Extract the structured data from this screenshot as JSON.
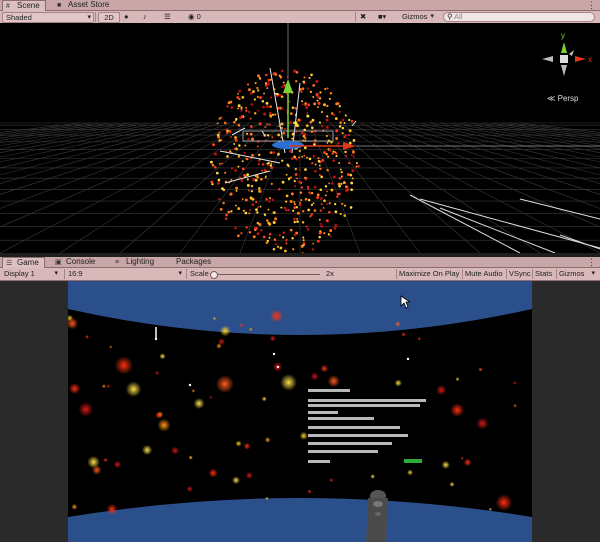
{
  "scene_tabs": [
    {
      "label": "Scene",
      "icon": "hash-icon",
      "active": true
    },
    {
      "label": "Asset Store",
      "icon": "cart-icon",
      "active": false
    }
  ],
  "scene_toolbar": {
    "shading_mode": "Shaded",
    "mode_2d": "2D",
    "effects_count": "0",
    "gizmos_label": "Gizmos",
    "search_placeholder": "All"
  },
  "scene_view": {
    "projection_label": "Persp",
    "gizmo_y": "y",
    "gizmo_x": "x",
    "colors": {
      "axis_y": "#7cd13a",
      "axis_x": "#e0371b",
      "background": "#000000",
      "grid": "#3a3a3a"
    }
  },
  "game_tabs": [
    {
      "label": "Game",
      "icon": "gamepad-icon",
      "active": true
    },
    {
      "label": "Console",
      "icon": "console-icon",
      "active": false
    },
    {
      "label": "Lighting",
      "icon": "lighting-icon",
      "active": false
    },
    {
      "label": "Packages",
      "icon": "package-icon",
      "active": false
    }
  ],
  "game_toolbar": {
    "display": "Display 1",
    "aspect": "16:9",
    "scale_label": "Scale",
    "scale_value": "2x",
    "scale_fraction": 0.0,
    "maximize_on_play": "Maximize On Play",
    "mute_audio": "Mute Audio",
    "vsync": "VSync",
    "stats": "Stats",
    "gizmos": "Gizmos"
  },
  "game_view": {
    "colors": {
      "sky": "#2a4f8a",
      "floor": "#2a4f8a",
      "space": "#000000",
      "panel_button": "#2faa3a"
    }
  }
}
